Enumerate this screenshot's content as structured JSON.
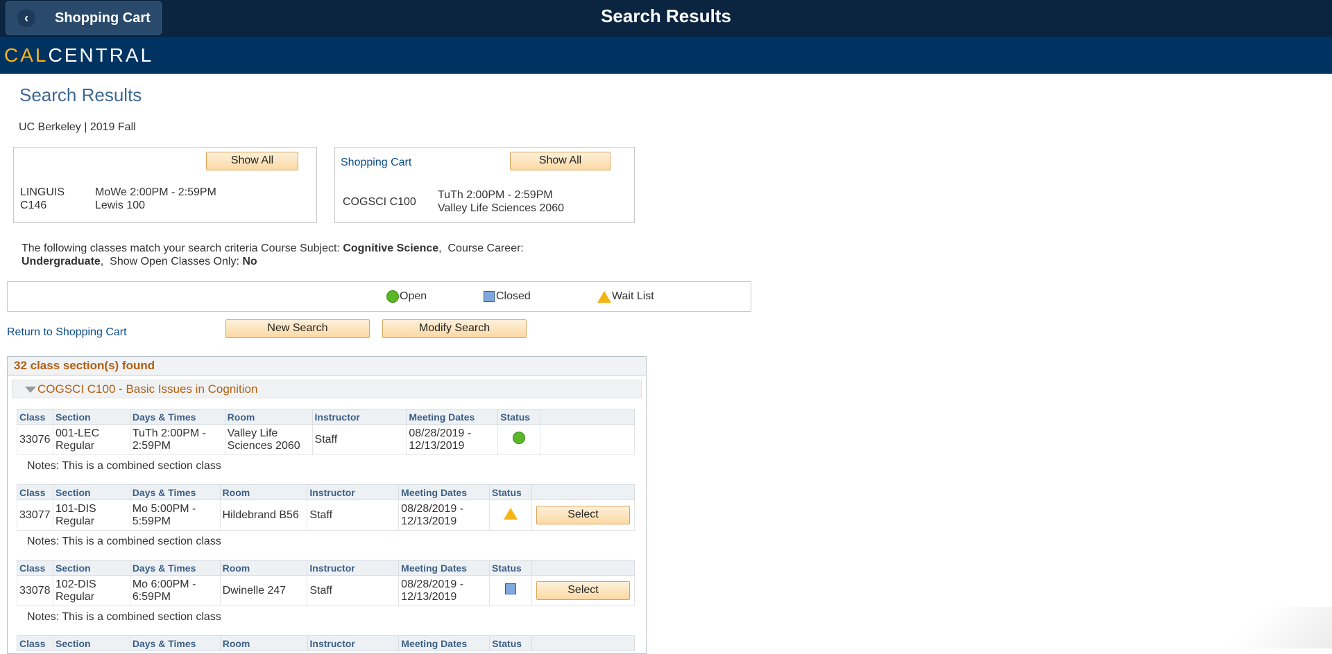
{
  "header": {
    "back_label": "Shopping Cart",
    "title": "Search Results",
    "brand_cal": "CAL",
    "brand_central": "CENTRAL"
  },
  "page": {
    "title": "Search Results",
    "term": "UC Berkeley | 2019 Fall"
  },
  "enrolled_box": {
    "show_all_label": "Show All",
    "course_line1": "LINGUIS",
    "course_line2": "C146",
    "times": "MoWe 2:00PM - 2:59PM",
    "room": "Lewis 100"
  },
  "cart_box": {
    "title": "Shopping Cart",
    "show_all_label": "Show All",
    "course": "COGSCI C100",
    "times": "TuTh 2:00PM - 2:59PM",
    "room": "Valley Life Sciences 2060"
  },
  "criteria": {
    "intro": "The following classes match your search criteria Course Subject:",
    "subject": "Cognitive Science",
    "career_label": "Course Career:",
    "career": "Undergraduate",
    "open_only_label": "Show Open Classes Only:",
    "open_only": "No"
  },
  "legend": {
    "open": "Open",
    "closed": "Closed",
    "wait": "Wait List"
  },
  "actions": {
    "return_link": "Return to Shopping Cart",
    "new_search": "New Search",
    "modify_search": "Modify Search"
  },
  "results": {
    "count_text": "32 class section(s) found",
    "course_title": "COGSCI C100 - Basic Issues in Cognition",
    "columns": [
      "Class",
      "Section",
      "Days & Times",
      "Room",
      "Instructor",
      "Meeting Dates",
      "Status"
    ],
    "notes": "Notes: This is a combined section class",
    "select_label": "Select",
    "sections": [
      {
        "class": "33076",
        "section_1": "001-LEC",
        "section_2": "Regular",
        "days_1": "TuTh 2:00PM -",
        "days_2": "2:59PM",
        "room_1": "Valley Life",
        "room_2": "Sciences 2060",
        "instructor": "Staff",
        "dates_1": "08/28/2019 -",
        "dates_2": "12/13/2019",
        "status": "open"
      },
      {
        "class": "33077",
        "section_1": "101-DIS",
        "section_2": "Regular",
        "days_1": "Mo 5:00PM -",
        "days_2": "5:59PM",
        "room_1": "Hildebrand B56",
        "room_2": "",
        "instructor": "Staff",
        "dates_1": "08/28/2019 -",
        "dates_2": "12/13/2019",
        "status": "wait"
      },
      {
        "class": "33078",
        "section_1": "102-DIS",
        "section_2": "Regular",
        "days_1": "Mo 6:00PM -",
        "days_2": "6:59PM",
        "room_1": "Dwinelle 247",
        "room_2": "",
        "instructor": "Staff",
        "dates_1": "08/28/2019 -",
        "dates_2": "12/13/2019",
        "status": "closed"
      }
    ]
  },
  "colors": {
    "topbar": "#0b2440",
    "brandbar": "#003262",
    "brand_gold": "#fdb515",
    "link": "#0a4d8c",
    "accent_orange": "#b25f11"
  }
}
